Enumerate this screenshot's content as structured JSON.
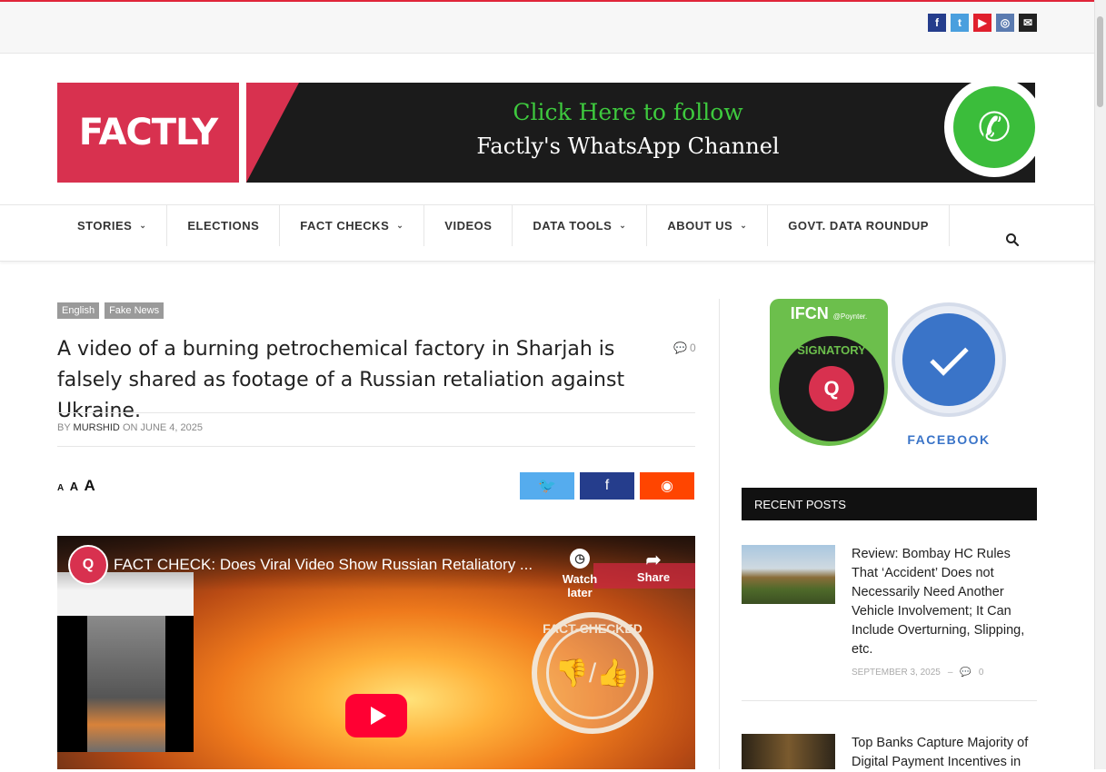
{
  "social": {
    "icons": [
      {
        "name": "facebook-icon",
        "glyph": "f",
        "color": "#253d8c"
      },
      {
        "name": "twitter-icon",
        "glyph": "t",
        "color": "#4a9fde"
      },
      {
        "name": "youtube-icon",
        "glyph": "▶",
        "color": "#e0202d"
      },
      {
        "name": "instagram-icon",
        "glyph": "◎",
        "color": "#5b7bb0"
      },
      {
        "name": "email-icon",
        "glyph": "✉",
        "color": "#222222"
      }
    ]
  },
  "logo": {
    "text": "FACTLY"
  },
  "banner": {
    "line1": "Click Here to follow",
    "line2": "Factly's WhatsApp Channel"
  },
  "nav": {
    "items": [
      {
        "label": "STORIES",
        "dropdown": true
      },
      {
        "label": "ELECTIONS",
        "dropdown": false
      },
      {
        "label": "FACT CHECKS",
        "dropdown": true
      },
      {
        "label": "VIDEOS",
        "dropdown": false
      },
      {
        "label": "DATA TOOLS",
        "dropdown": true
      },
      {
        "label": "ABOUT US",
        "dropdown": true
      },
      {
        "label": "GOVT. DATA ROUNDUP",
        "dropdown": false
      }
    ]
  },
  "article": {
    "tags": [
      "English",
      "Fake News"
    ],
    "headline": "A video of a burning petrochemical factory in Sharjah is falsely shared as footage of a Russian retaliation against Ukraine.",
    "comment_count": "0",
    "by": "BY",
    "author": "MURSHID",
    "on": "ON",
    "date": "JUNE 4, 2025",
    "font_sizes": [
      "A",
      "A",
      "A"
    ],
    "share_buttons": [
      {
        "name": "twitter-share-button",
        "glyph": "🐦",
        "color": "#55acee"
      },
      {
        "name": "facebook-share-button",
        "glyph": "f",
        "color": "#253d8c"
      },
      {
        "name": "reddit-share-button",
        "glyph": "◉",
        "color": "#ff4500"
      }
    ]
  },
  "video": {
    "title": "FACT CHECK: Does Viral Video Show Russian Retaliatory ...",
    "watch_later": "Watch later",
    "share": "Share",
    "stamp": "FACT-CHECKED"
  },
  "sidebar": {
    "ifcn_title": "IFCN",
    "ifcn_poynter": "@Poynter.",
    "ifcn_signatory": "SIGNATORY",
    "facebook_label": "FACEBOOK",
    "recent_heading": "RECENT POSTS",
    "posts": [
      {
        "title": "Review: Bombay HC Rules That ‘Accident’ Does not Necessarily Need Another Vehicle Involvement; It Can Include Overturning, Slipping, etc.",
        "date": "SEPTEMBER 3, 2025",
        "comments": "0"
      },
      {
        "title": "Top Banks Capture Majority of Digital Payment Incentives in"
      }
    ]
  }
}
